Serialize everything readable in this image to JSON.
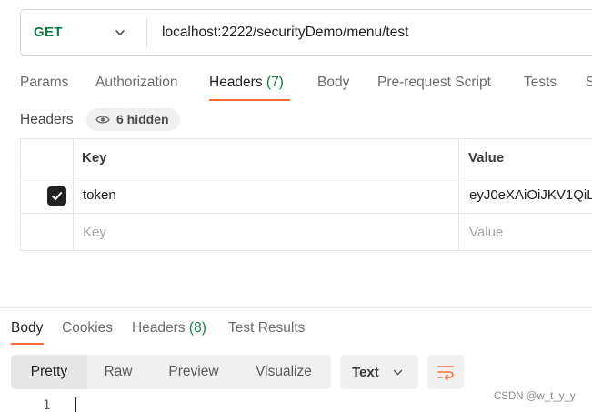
{
  "request": {
    "method": "GET",
    "url": "localhost:2222/securityDemo/menu/test"
  },
  "request_tabs": [
    {
      "label": "Params"
    },
    {
      "label": "Authorization"
    },
    {
      "label": "Headers",
      "count": "(7)"
    },
    {
      "label": "Body"
    },
    {
      "label": "Pre-request Script"
    },
    {
      "label": "Tests"
    },
    {
      "label": "S"
    }
  ],
  "headers_section": {
    "title": "Headers",
    "hidden_label": "6 hidden",
    "columns": {
      "key": "Key",
      "value": "Value"
    },
    "rows": [
      {
        "checked": true,
        "key": "token",
        "value": "eyJ0eXAiOiJKV1QiLC"
      }
    ],
    "placeholder": {
      "key": "Key",
      "value": "Value"
    }
  },
  "response_tabs": [
    {
      "label": "Body"
    },
    {
      "label": "Cookies"
    },
    {
      "label": "Headers",
      "count": "(8)"
    },
    {
      "label": "Test Results"
    }
  ],
  "view_modes": [
    "Pretty",
    "Raw",
    "Preview",
    "Visualize"
  ],
  "format_select": "Text",
  "editor": {
    "line_number": "1"
  },
  "watermark": "CSDN @w_t_y_y",
  "colors": {
    "accent": "#ff6c37",
    "method_get": "#107c41",
    "count": "#107c41"
  }
}
